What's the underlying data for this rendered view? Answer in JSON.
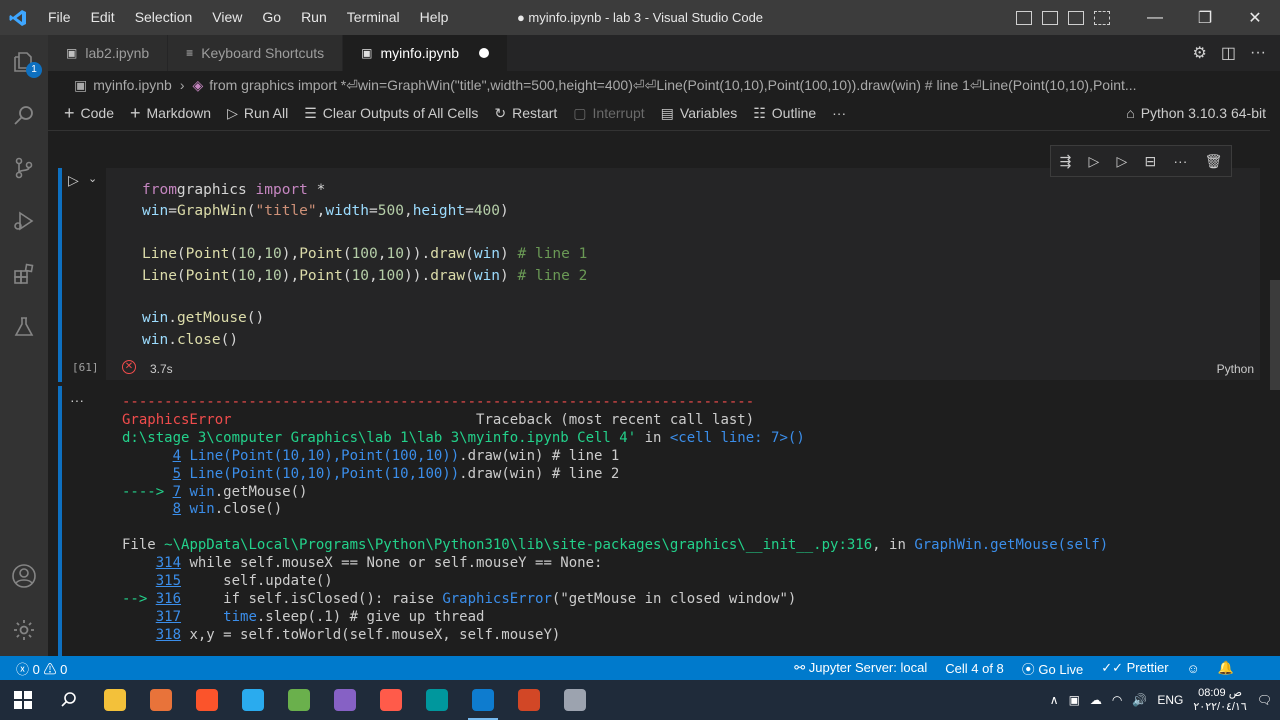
{
  "titlebar": {
    "menus": [
      "File",
      "Edit",
      "Selection",
      "View",
      "Go",
      "Run",
      "Terminal",
      "Help"
    ],
    "title": "● myinfo.ipynb - lab 3 - Visual Studio Code",
    "minimize": "—",
    "restore": "❐",
    "close": "✕"
  },
  "activity": {
    "badge": "1"
  },
  "tabs": [
    {
      "label": "lab2.ipynb",
      "icon": "notebook-icon"
    },
    {
      "label": "Keyboard Shortcuts",
      "icon": "list-icon"
    },
    {
      "label": "myinfo.ipynb",
      "icon": "notebook-icon",
      "active": true,
      "dirty": true
    }
  ],
  "breadcrumb": {
    "file": "myinfo.ipynb",
    "sep": "›",
    "symbol": "from graphics import *⏎win=GraphWin(\"title\",width=500,height=400)⏎⏎Line(Point(10,10),Point(100,10)).draw(win) # line 1⏎Line(Point(10,10),Point..."
  },
  "toolbar": {
    "code": "Code",
    "markdown": "Markdown",
    "run_all": "Run All",
    "clear_outputs": "Clear Outputs of All Cells",
    "restart": "Restart",
    "interrupt": "Interrupt",
    "variables": "Variables",
    "outline": "Outline",
    "more": "···",
    "kernel": "Python 3.10.3 64-bit"
  },
  "cell": {
    "exec_count": "[61]",
    "duration": "3.7s",
    "language": "Python",
    "status_icon": "✕",
    "run_icon": "▷",
    "expand_icon": "⌄",
    "output_menu": "···",
    "code_lines": [
      [
        [
          "kw",
          "from"
        ],
        [
          "",
          "graphics "
        ],
        [
          "kw",
          "import"
        ],
        [
          "",
          " *"
        ]
      ],
      [
        [
          "vr",
          "win"
        ],
        [
          "",
          "="
        ],
        [
          "fn",
          "GraphWin"
        ],
        [
          "",
          "("
        ],
        [
          "st",
          "\"title\""
        ],
        [
          "",
          ","
        ],
        [
          "vr",
          "width"
        ],
        [
          "",
          "="
        ],
        [
          "nu",
          "500"
        ],
        [
          "",
          ","
        ],
        [
          "vr",
          "height"
        ],
        [
          "",
          "="
        ],
        [
          "nu",
          "400"
        ],
        [
          "",
          ")"
        ]
      ],
      [],
      [
        [
          "fn",
          "Line"
        ],
        [
          "",
          "("
        ],
        [
          "fn",
          "Point"
        ],
        [
          "",
          "("
        ],
        [
          "nu",
          "10"
        ],
        [
          "",
          ","
        ],
        [
          "nu",
          "10"
        ],
        [
          "",
          "),"
        ],
        [
          "fn",
          "Point"
        ],
        [
          "",
          "("
        ],
        [
          "nu",
          "100"
        ],
        [
          "",
          ","
        ],
        [
          "nu",
          "10"
        ],
        [
          "",
          "))."
        ],
        [
          "fn",
          "draw"
        ],
        [
          "",
          "("
        ],
        [
          "vr",
          "win"
        ],
        [
          "",
          ") "
        ],
        [
          "cm",
          "# line 1"
        ]
      ],
      [
        [
          "fn",
          "Line"
        ],
        [
          "",
          "("
        ],
        [
          "fn",
          "Point"
        ],
        [
          "",
          "("
        ],
        [
          "nu",
          "10"
        ],
        [
          "",
          ","
        ],
        [
          "nu",
          "10"
        ],
        [
          "",
          "),"
        ],
        [
          "fn",
          "Point"
        ],
        [
          "",
          "("
        ],
        [
          "nu",
          "10"
        ],
        [
          "",
          ","
        ],
        [
          "nu",
          "100"
        ],
        [
          "",
          "))."
        ],
        [
          "fn",
          "draw"
        ],
        [
          "",
          "("
        ],
        [
          "vr",
          "win"
        ],
        [
          "",
          ") "
        ],
        [
          "cm",
          "# line 2"
        ]
      ],
      [],
      [
        [
          "vr",
          "win"
        ],
        [
          "",
          "."
        ],
        [
          "fn",
          "getMouse"
        ],
        [
          "",
          "()"
        ]
      ],
      [
        [
          "vr",
          "win"
        ],
        [
          "",
          "."
        ],
        [
          "fn",
          "close"
        ],
        [
          "",
          "()"
        ]
      ]
    ]
  },
  "output_lines": [
    [
      [
        "er",
        "---------------------------------------------------------------------------"
      ]
    ],
    [
      [
        "er",
        "GraphicsError"
      ],
      [
        "",
        "                             Traceback (most recent call last)"
      ]
    ],
    [
      [
        "gn",
        "d:\\stage 3\\computer Graphics\\lab 1\\lab 3\\myinfo.ipynb Cell 4'"
      ],
      [
        "",
        " in "
      ],
      [
        "bl",
        "<cell line: 7>"
      ],
      [
        "bl",
        "()"
      ]
    ],
    [
      [
        "",
        "      "
      ],
      [
        "bl ul",
        "4"
      ],
      [
        "",
        ""
      ],
      [
        "bl",
        " Line(Point(10,10),Point(100,10))"
      ],
      [
        "",
        ".draw(win) # line 1"
      ]
    ],
    [
      [
        "",
        "      "
      ],
      [
        "bl ul",
        "5"
      ],
      [
        "bl",
        " Line(Point(10,10),Point(10,100))"
      ],
      [
        "",
        ".draw(win) # line 2"
      ]
    ],
    [
      [
        "gn",
        "----> "
      ],
      [
        "bl ul",
        "7"
      ],
      [
        "bl",
        " win"
      ],
      [
        "",
        ".getMouse()"
      ]
    ],
    [
      [
        "",
        "      "
      ],
      [
        "bl ul",
        "8"
      ],
      [
        "bl",
        " win"
      ],
      [
        "",
        ".close()"
      ]
    ],
    [],
    [
      [
        "",
        "File "
      ],
      [
        "gn",
        "~\\AppData\\Local\\Programs\\Python\\Python310\\lib\\site-packages\\graphics\\__init__.py:316"
      ],
      [
        "",
        ", in "
      ],
      [
        "bl",
        "GraphWin.getMouse(self)"
      ]
    ],
    [
      [
        "",
        "    "
      ],
      [
        "bl ul",
        "314"
      ],
      [
        "",
        " while self.mouseX == None or self.mouseY == None:"
      ]
    ],
    [
      [
        "",
        "    "
      ],
      [
        "bl ul",
        "315"
      ],
      [
        "",
        "     self.update()"
      ]
    ],
    [
      [
        "gn",
        "--> "
      ],
      [
        "bl ul",
        "316"
      ],
      [
        "",
        "     if self.isClosed(): raise "
      ],
      [
        "bl",
        "GraphicsError"
      ],
      [
        "",
        "(\"getMouse in closed window\")"
      ]
    ],
    [
      [
        "",
        "    "
      ],
      [
        "bl ul",
        "317"
      ],
      [
        "bl",
        "     time"
      ],
      [
        "",
        ".sleep(.1) # give up thread"
      ]
    ],
    [
      [
        "",
        "    "
      ],
      [
        "bl ul",
        "318"
      ],
      [
        "",
        " x,y = self.toWorld(self.mouseX, self.mouseY)"
      ]
    ]
  ],
  "status": {
    "errors": "0",
    "warnings": "0",
    "jupyter": "Jupyter Server: local",
    "cell": "Cell 4 of 8",
    "golive": "Go Live",
    "prettier": "Prettier"
  },
  "taskbar": {
    "lang": "ENG",
    "time": "08:09 ص",
    "date": "٢٠٢٢/٠٤/١٦",
    "apps": [
      {
        "name": "file-explorer-icon",
        "color": "#f3c13a"
      },
      {
        "name": "photo-editor-icon",
        "color": "#e8733a"
      },
      {
        "name": "brave-browser-icon",
        "color": "#fb542b"
      },
      {
        "name": "telegram-icon",
        "color": "#2aabee"
      },
      {
        "name": "codeblocks-icon",
        "color": "#6ab04c"
      },
      {
        "name": "visual-studio-icon",
        "color": "#8661c5"
      },
      {
        "name": "git-icon",
        "color": "#ff5b4a"
      },
      {
        "name": "arduino-icon",
        "color": "#00979d"
      },
      {
        "name": "vscode-icon",
        "color": "#0e7ccf",
        "active": true
      },
      {
        "name": "powerpoint-icon",
        "color": "#d24726"
      },
      {
        "name": "wing-ide-icon",
        "color": "#9ca3af"
      }
    ]
  }
}
